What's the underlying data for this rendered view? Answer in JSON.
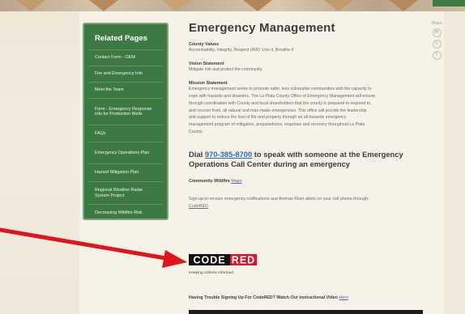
{
  "sidebar": {
    "title": "Related Pages",
    "items": [
      {
        "label": "Contact Form - OEM"
      },
      {
        "label": "Fire and Emergency Info"
      },
      {
        "label": "Meet the Team"
      },
      {
        "label": "Form - Emergency Response Info for Production Wells"
      },
      {
        "label": "FAQs"
      },
      {
        "label": "Emergency Operations Plan"
      },
      {
        "label": "Hazard Mitigation Plan"
      },
      {
        "label": "Regional Weather Radar System Project"
      },
      {
        "label": "Decreasing Wildfire Risk"
      }
    ]
  },
  "main": {
    "title": "Emergency Management",
    "county_values_heading": "County Values",
    "county_values_text": "Accountability, Integrity, Respect (AIR) 'Live it, Breathe it'",
    "vision_heading": "Vision Statement",
    "vision_text": "Mitigate risk and protect the community.",
    "mission_heading": "Mission Statement",
    "mission_lines": [
      "Emergency management seeks to promote safer, less vulnerable communities with the capacity to",
      "cope with hazards and disasters.  The La Plata County Office of Emergency Management will ensure,",
      "through coordination with County and local shareholders that the county is prepared to respond to,",
      "and recover from, all natural and man-made emergencies. This office will provide the leadership",
      "and support to reduce the loss of life and property through an all-hazards emergency",
      "management program of mitigation, preparedness, response and recovery throughout La Plata",
      "County."
    ],
    "dial_prefix": "Dial ",
    "phone": "970-385-8700",
    "dial_suffix_1": " to speak with someone at the Emergency",
    "dial_line_2": "Operations Call Center during an emergency",
    "wildfire_label": "Community Wildfire ",
    "wildfire_link": "Maps",
    "signup_text": "Sign up to receive emergency notifications and Animas River alerts on your cell phone through",
    "codered_link": "CodeRED",
    "codered_tagline": "Keeping citizens informed",
    "trouble_text": "Having Trouble Signing Up For CodeRED? Watch Our Instructional Video ",
    "trouble_link": "Here"
  },
  "share": {
    "label": "Share",
    "buttons": [
      {
        "icon": "email-icon",
        "glyph": "✉"
      },
      {
        "icon": "twitter-icon",
        "glyph": "t"
      },
      {
        "icon": "facebook-icon",
        "glyph": "f"
      }
    ]
  },
  "colors": {
    "sidebar_green": "#3d7a43",
    "link_blue": "#2a6fb5",
    "codered_red": "#d3192c",
    "arrow_red": "#e0141b"
  },
  "logo": {
    "text_code": "CODE",
    "text_red": "RED"
  }
}
